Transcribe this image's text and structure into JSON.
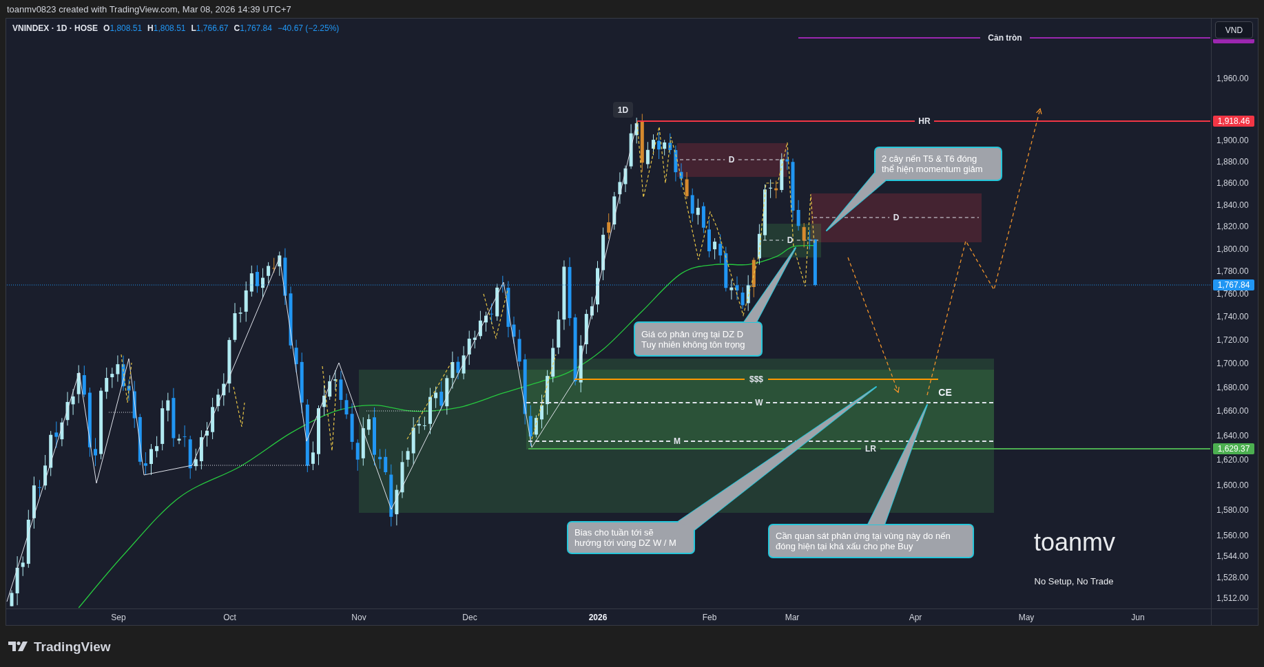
{
  "header": {
    "caption": "toanmv0823 created with TradingView.com, Mar 08, 2026 14:39 UTC+7"
  },
  "legend": {
    "symbol": "VNINDEX · 1D · HOSE",
    "values": [
      {
        "key": "O",
        "value": "1,808.51"
      },
      {
        "key": "H",
        "value": "1,808.51"
      },
      {
        "key": "L",
        "value": "1,766.67"
      },
      {
        "key": "C",
        "value": "1,767.84"
      }
    ],
    "change": "−40.67 (−2.25%)"
  },
  "chart": {
    "interval_badge": "1D",
    "levels": [
      {
        "kind": "solid",
        "label": "Cản tròn",
        "color": "#9c27b0"
      },
      {
        "kind": "solid",
        "label": "HR",
        "color": "#f23645"
      },
      {
        "kind": "solid",
        "label": "$$$",
        "color": "#ff9800"
      },
      {
        "kind": "dashed",
        "label": "W",
        "color": "#e0e3eb"
      },
      {
        "kind": "dashed",
        "label": "M",
        "color": "#e0e3eb"
      },
      {
        "kind": "solid",
        "label": "LR",
        "color": "#4caf50"
      }
    ],
    "zones": [
      {
        "kind": "supply",
        "label": "D"
      },
      {
        "kind": "supply",
        "label": "D"
      },
      {
        "kind": "demand",
        "label": "D"
      },
      {
        "kind": "demand"
      },
      {
        "kind": "demand"
      }
    ],
    "labels": [
      {
        "text": "CE"
      }
    ],
    "callouts": [
      {
        "text": "2 cây nến T5 & T6 đóng\nthể hiện momentum giảm"
      },
      {
        "text": "Giá có phản ứng tại DZ D\nTuy nhiên không tôn trọng"
      },
      {
        "text": "Bias cho tuần tới sẽ\nhướng tới vùng DZ W / M"
      },
      {
        "text": "Cần quan sát phản ứng tại vùng này do nến\nđóng hiện tại khá xấu cho phe Buy"
      }
    ],
    "signature": "toanmv",
    "tagline": "No Setup, No Trade"
  },
  "price_axis": {
    "currency_button": "VND",
    "ticks": [
      "1,960.00",
      "1,900.00",
      "1,880.00",
      "1,860.00",
      "1,840.00",
      "1,820.00",
      "1,800.00",
      "1,780.00",
      "1,760.00",
      "1,740.00",
      "1,720.00",
      "1,700.00",
      "1,680.00",
      "1,660.00",
      "1,640.00",
      "1,620.00",
      "1,600.00",
      "1,580.00",
      "1,560.00",
      "1,544.00",
      "1,528.00",
      "1,512.00"
    ],
    "markers": [
      {
        "label": "1,918.46",
        "color": "#f23645"
      },
      {
        "label": "1,767.84",
        "color": "#2196f3"
      },
      {
        "label": "1,629.37",
        "color": "#4caf50"
      }
    ]
  },
  "time_axis": [
    {
      "label": "Sep",
      "kind": "month"
    },
    {
      "label": "Oct",
      "kind": "month"
    },
    {
      "label": "Nov",
      "kind": "month"
    },
    {
      "label": "Dec",
      "kind": "month"
    },
    {
      "label": "2026",
      "kind": "year"
    },
    {
      "label": "Feb",
      "kind": "month"
    },
    {
      "label": "Mar",
      "kind": "month"
    },
    {
      "label": "Apr",
      "kind": "month"
    },
    {
      "label": "May",
      "kind": "month"
    },
    {
      "label": "Jun",
      "kind": "month"
    }
  ],
  "footer": {
    "brand": "TradingView"
  }
}
